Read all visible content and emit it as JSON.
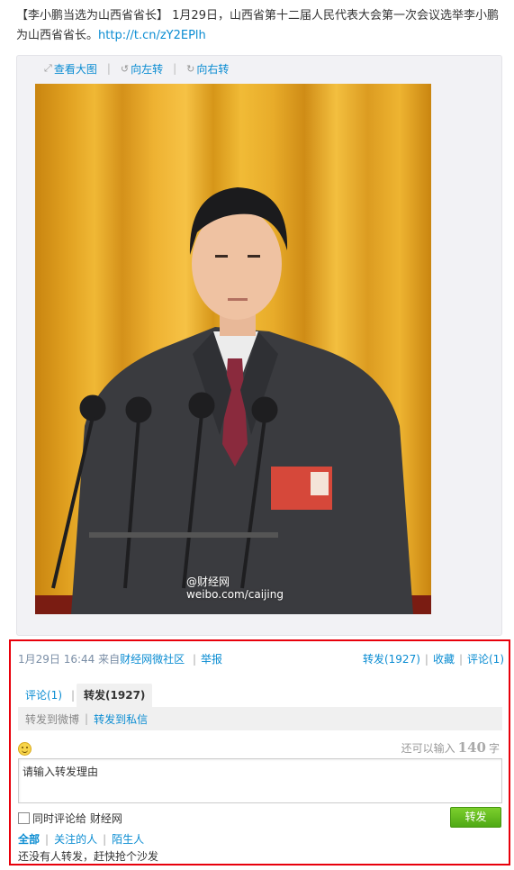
{
  "post": {
    "headline": "【李小鹏当选为山西省省长】",
    "body": " 1月29日，山西省第十二届人民代表大会第一次会议选举李小鹏为山西省省长。",
    "link": "http://t.cn/zY2EPlh"
  },
  "media_toolbar": {
    "view_large": "查看大图",
    "rotate_left": "向左转",
    "rotate_right": "向右转",
    "view_large_icon": "expand-icon",
    "rotate_left_icon": "rotate-left-icon",
    "rotate_right_icon": "rotate-right-icon"
  },
  "photo": {
    "watermark_line1": "@财经网",
    "watermark_line2": "weibo.com/caijing"
  },
  "meta": {
    "timestamp": "1月29日 16:44",
    "source_prefix": " 来自",
    "source": "财经网微社区",
    "report": "举报",
    "repost": "转发(1927)",
    "favorite": "收藏",
    "comment": "评论(1)"
  },
  "tabs": {
    "comment": "评论(1)",
    "repost": "转发(1927)"
  },
  "sub_tabs": {
    "to_weibo": "转发到微博",
    "to_private": "转发到私信"
  },
  "composer": {
    "emoji_icon": "smiley-icon",
    "counter_prefix": "还可以输入",
    "counter_value": "140",
    "counter_suffix": "字",
    "placeholder": "请输入转发理由",
    "also_comment_label": "同时评论给 财经网",
    "submit_label": "转发"
  },
  "filters": {
    "all": "全部",
    "following": "关注的人",
    "strangers": "陌生人"
  },
  "empty_note": "还没有人转发，赶快抢个沙发",
  "colors": {
    "link": "#0a8cd2",
    "highlight_border": "#e8000b",
    "submit_green": "#5cb31c"
  }
}
